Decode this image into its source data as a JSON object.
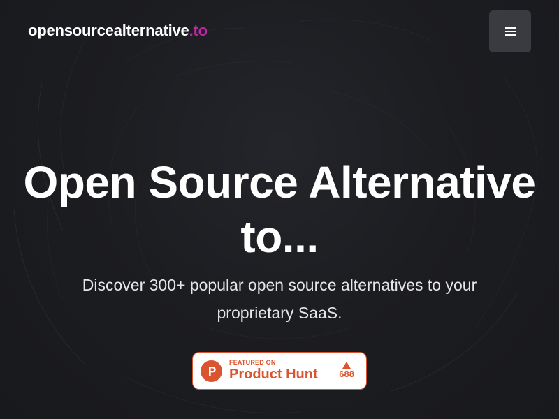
{
  "header": {
    "logo_main": "opensourcealternative",
    "logo_tld": ".to",
    "menu_icon": "hamburger-menu-icon"
  },
  "hero": {
    "title": "Open Source Alternative to...",
    "subtitle": "Discover 300+ popular open source alternatives to your proprietary SaaS."
  },
  "badge": {
    "featured_label": "FEATURED ON",
    "name": "Product Hunt",
    "votes": "688",
    "logo_icon": "product-hunt-logo-icon",
    "upvote_icon": "upvote-triangle-icon"
  },
  "colors": {
    "background": "#1c1d21",
    "accent": "#c026a6",
    "menu_button": "#3a3b40",
    "product_hunt": "#da552f"
  }
}
